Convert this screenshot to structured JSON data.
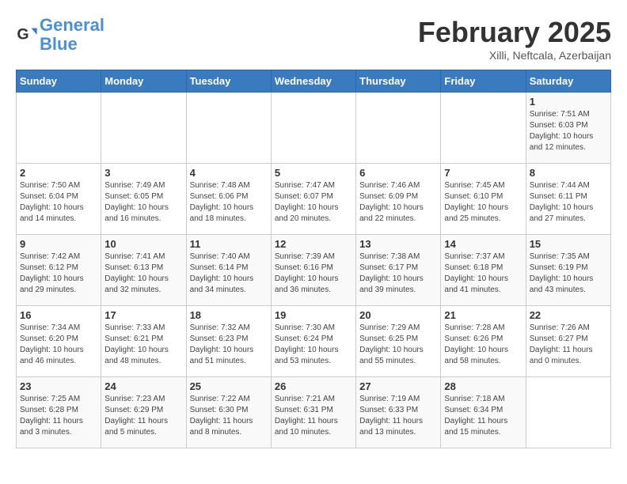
{
  "logo": {
    "line1": "General",
    "line2": "Blue"
  },
  "title": "February 2025",
  "subtitle": "Xilli, Neftcala, Azerbaijan",
  "days_of_week": [
    "Sunday",
    "Monday",
    "Tuesday",
    "Wednesday",
    "Thursday",
    "Friday",
    "Saturday"
  ],
  "weeks": [
    [
      {
        "day": "",
        "info": ""
      },
      {
        "day": "",
        "info": ""
      },
      {
        "day": "",
        "info": ""
      },
      {
        "day": "",
        "info": ""
      },
      {
        "day": "",
        "info": ""
      },
      {
        "day": "",
        "info": ""
      },
      {
        "day": "1",
        "info": "Sunrise: 7:51 AM\nSunset: 6:03 PM\nDaylight: 10 hours\nand 12 minutes."
      }
    ],
    [
      {
        "day": "2",
        "info": "Sunrise: 7:50 AM\nSunset: 6:04 PM\nDaylight: 10 hours\nand 14 minutes."
      },
      {
        "day": "3",
        "info": "Sunrise: 7:49 AM\nSunset: 6:05 PM\nDaylight: 10 hours\nand 16 minutes."
      },
      {
        "day": "4",
        "info": "Sunrise: 7:48 AM\nSunset: 6:06 PM\nDaylight: 10 hours\nand 18 minutes."
      },
      {
        "day": "5",
        "info": "Sunrise: 7:47 AM\nSunset: 6:07 PM\nDaylight: 10 hours\nand 20 minutes."
      },
      {
        "day": "6",
        "info": "Sunrise: 7:46 AM\nSunset: 6:09 PM\nDaylight: 10 hours\nand 22 minutes."
      },
      {
        "day": "7",
        "info": "Sunrise: 7:45 AM\nSunset: 6:10 PM\nDaylight: 10 hours\nand 25 minutes."
      },
      {
        "day": "8",
        "info": "Sunrise: 7:44 AM\nSunset: 6:11 PM\nDaylight: 10 hours\nand 27 minutes."
      }
    ],
    [
      {
        "day": "9",
        "info": "Sunrise: 7:42 AM\nSunset: 6:12 PM\nDaylight: 10 hours\nand 29 minutes."
      },
      {
        "day": "10",
        "info": "Sunrise: 7:41 AM\nSunset: 6:13 PM\nDaylight: 10 hours\nand 32 minutes."
      },
      {
        "day": "11",
        "info": "Sunrise: 7:40 AM\nSunset: 6:14 PM\nDaylight: 10 hours\nand 34 minutes."
      },
      {
        "day": "12",
        "info": "Sunrise: 7:39 AM\nSunset: 6:16 PM\nDaylight: 10 hours\nand 36 minutes."
      },
      {
        "day": "13",
        "info": "Sunrise: 7:38 AM\nSunset: 6:17 PM\nDaylight: 10 hours\nand 39 minutes."
      },
      {
        "day": "14",
        "info": "Sunrise: 7:37 AM\nSunset: 6:18 PM\nDaylight: 10 hours\nand 41 minutes."
      },
      {
        "day": "15",
        "info": "Sunrise: 7:35 AM\nSunset: 6:19 PM\nDaylight: 10 hours\nand 43 minutes."
      }
    ],
    [
      {
        "day": "16",
        "info": "Sunrise: 7:34 AM\nSunset: 6:20 PM\nDaylight: 10 hours\nand 46 minutes."
      },
      {
        "day": "17",
        "info": "Sunrise: 7:33 AM\nSunset: 6:21 PM\nDaylight: 10 hours\nand 48 minutes."
      },
      {
        "day": "18",
        "info": "Sunrise: 7:32 AM\nSunset: 6:23 PM\nDaylight: 10 hours\nand 51 minutes."
      },
      {
        "day": "19",
        "info": "Sunrise: 7:30 AM\nSunset: 6:24 PM\nDaylight: 10 hours\nand 53 minutes."
      },
      {
        "day": "20",
        "info": "Sunrise: 7:29 AM\nSunset: 6:25 PM\nDaylight: 10 hours\nand 55 minutes."
      },
      {
        "day": "21",
        "info": "Sunrise: 7:28 AM\nSunset: 6:26 PM\nDaylight: 10 hours\nand 58 minutes."
      },
      {
        "day": "22",
        "info": "Sunrise: 7:26 AM\nSunset: 6:27 PM\nDaylight: 11 hours\nand 0 minutes."
      }
    ],
    [
      {
        "day": "23",
        "info": "Sunrise: 7:25 AM\nSunset: 6:28 PM\nDaylight: 11 hours\nand 3 minutes."
      },
      {
        "day": "24",
        "info": "Sunrise: 7:23 AM\nSunset: 6:29 PM\nDaylight: 11 hours\nand 5 minutes."
      },
      {
        "day": "25",
        "info": "Sunrise: 7:22 AM\nSunset: 6:30 PM\nDaylight: 11 hours\nand 8 minutes."
      },
      {
        "day": "26",
        "info": "Sunrise: 7:21 AM\nSunset: 6:31 PM\nDaylight: 11 hours\nand 10 minutes."
      },
      {
        "day": "27",
        "info": "Sunrise: 7:19 AM\nSunset: 6:33 PM\nDaylight: 11 hours\nand 13 minutes."
      },
      {
        "day": "28",
        "info": "Sunrise: 7:18 AM\nSunset: 6:34 PM\nDaylight: 11 hours\nand 15 minutes."
      },
      {
        "day": "",
        "info": ""
      }
    ]
  ]
}
